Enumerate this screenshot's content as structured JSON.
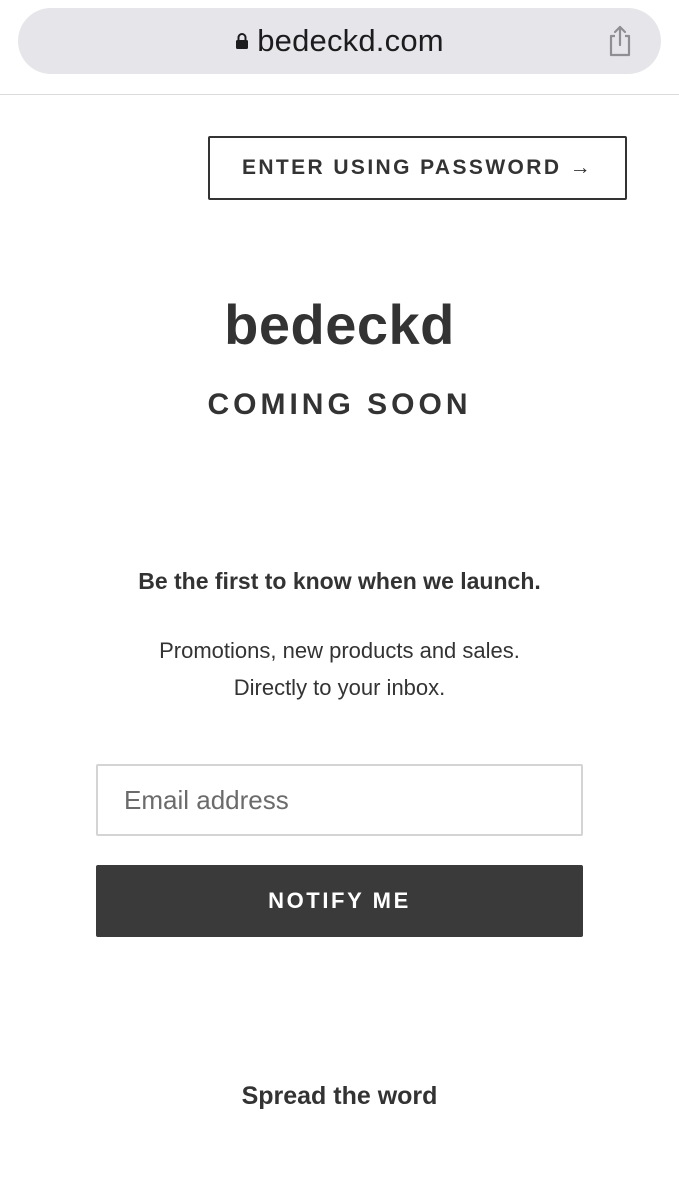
{
  "browser": {
    "url": "bedeckd.com",
    "lock_icon": "lock-icon",
    "share_icon": "share-icon"
  },
  "header": {
    "password_button_label": "ENTER USING PASSWORD →"
  },
  "main": {
    "store_name": "bedeckd",
    "tagline": "COMING SOON",
    "signup_heading": "Be the first to know when we launch.",
    "signup_text_line1": "Promotions, new products and sales.",
    "signup_text_line2": "Directly to your inbox.",
    "email_placeholder": "Email address",
    "notify_button_label": "NOTIFY ME"
  },
  "footer": {
    "share_heading": "Spread the word"
  },
  "colors": {
    "text": "#333333",
    "button_background": "#3a3a3a",
    "url_bar_background": "#e6e6ea"
  }
}
